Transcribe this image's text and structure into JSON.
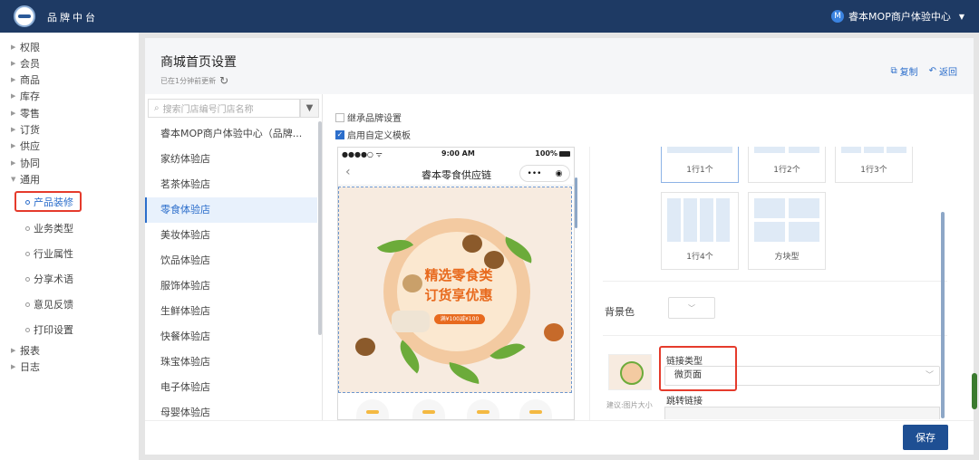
{
  "topbar": {
    "title": "品牌中台",
    "account": "睿本MOP商户体验中心",
    "account_badge": "M"
  },
  "sidebar": {
    "items": [
      {
        "label": "权限"
      },
      {
        "label": "会员"
      },
      {
        "label": "商品"
      },
      {
        "label": "库存"
      },
      {
        "label": "零售"
      },
      {
        "label": "订货"
      },
      {
        "label": "供应"
      },
      {
        "label": "协同"
      },
      {
        "label": "通用"
      }
    ],
    "sub_items": [
      {
        "label": "产品装修"
      },
      {
        "label": "业务类型"
      },
      {
        "label": "行业属性"
      },
      {
        "label": "分享术语"
      },
      {
        "label": "意见反馈"
      },
      {
        "label": "打印设置"
      }
    ],
    "bottom_items": [
      {
        "label": "报表"
      },
      {
        "label": "日志"
      }
    ]
  },
  "page": {
    "title": "商城首页设置",
    "saved_hint": "已在1分钟前更新",
    "copy_label": "复制",
    "back_label": "返回"
  },
  "stores": {
    "search_placeholder": "搜索门店编号门店名称",
    "list": [
      "睿本MOP商户体验中心（品牌...",
      "家纺体验店",
      "茗茶体验店",
      "零食体验店",
      "美妆体验店",
      "饮品体验店",
      "服饰体验店",
      "生鲜体验店",
      "快餐体验店",
      "珠宝体验店",
      "电子体验店",
      "母婴体验店"
    ],
    "active_index": 3
  },
  "editor": {
    "inherit_label": "继承品牌设置",
    "custom_label": "启用自定义模板",
    "phone": {
      "time": "9:00 AM",
      "battery": "100%",
      "signal": "●●●●○ ᯤ",
      "nav_title": "睿本零食供应链",
      "banner_title_1": "精选零食类",
      "banner_title_2": "订货享优惠",
      "banner_pill": "满¥100减¥100"
    },
    "layouts": [
      {
        "label": "1行1个"
      },
      {
        "label": "1行2个"
      },
      {
        "label": "1行3个"
      },
      {
        "label": "1行4个"
      },
      {
        "label": "方块型"
      }
    ],
    "bg_label": "背景色",
    "link_type_label": "链接类型",
    "link_type_value": "微页面",
    "jump_label": "跳转链接",
    "size_hint": "建议:图片大小"
  },
  "footer": {
    "save_label": "保存"
  },
  "colors": {
    "primary": "#1e3a64",
    "accent": "#2c6ecb",
    "highlight": "#e53b2c"
  }
}
